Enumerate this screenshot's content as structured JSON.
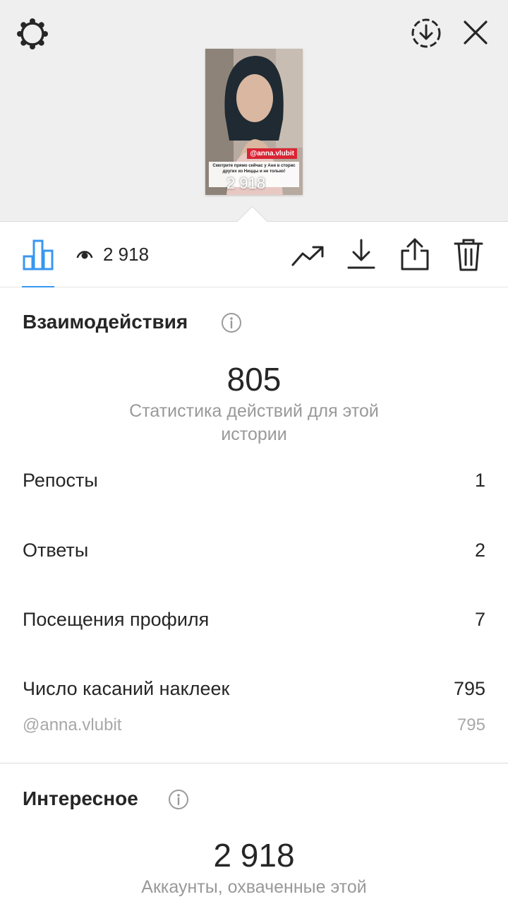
{
  "story_preview": {
    "sticker_tag": "@anna.vlubit",
    "caption": "Смотрите прямо сейчас у Ани в сторис других  из Ниццы и не только!",
    "views_overlay": "2 918"
  },
  "toolbar": {
    "views_count": "2 918",
    "accent": "#3897f0"
  },
  "interactions": {
    "title": "Взаимодействия",
    "total": "805",
    "subtitle": "Статистика действий для этой истории",
    "rows": [
      {
        "label": "Репосты",
        "value": "1"
      },
      {
        "label": "Ответы",
        "value": "2"
      },
      {
        "label": "Посещения профиля",
        "value": "7"
      },
      {
        "label": "Число касаний наклеек",
        "value": "795"
      }
    ],
    "sticker_detail": {
      "label": "@anna.vlubit",
      "value": "795"
    }
  },
  "discovery": {
    "title": "Интересное",
    "total": "2 918",
    "subtitle": "Аккаунты, охваченные этой"
  },
  "icons": [
    "settings-gear-icon",
    "download-circle-icon",
    "close-icon",
    "bar-chart-icon",
    "eye-icon",
    "trending-icon",
    "download-icon",
    "share-icon",
    "trash-icon",
    "info-icon"
  ]
}
